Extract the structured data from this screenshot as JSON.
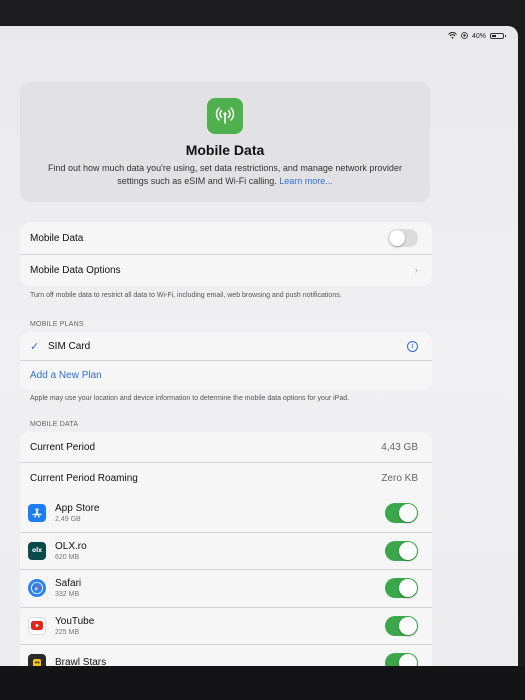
{
  "status": {
    "battery": "40%",
    "battery_level": 0.4
  },
  "header": {
    "icon": "antenna-icon",
    "title": "Mobile Data",
    "description": "Find out how much data you're using, set data restrictions, and manage network provider settings such as eSIM and Wi-Fi calling.",
    "learn_more": "Learn more..."
  },
  "main_settings": {
    "mobile_data_label": "Mobile Data",
    "mobile_data_on": false,
    "options_label": "Mobile Data Options",
    "footer": "Turn off mobile data to restrict all data to Wi-Fi, including email, web browsing and push notifications."
  },
  "plans": {
    "section_title": "MOBILE PLANS",
    "sim_card": "SIM Card",
    "add_plan": "Add a New Plan",
    "footer": "Apple may use your location and device information to determine the mobile data options for your iPad."
  },
  "usage": {
    "section_title": "MOBILE DATA",
    "current_period_label": "Current Period",
    "current_period_value": "4,43 GB",
    "roaming_label": "Current Period Roaming",
    "roaming_value": "Zero KB"
  },
  "apps": [
    {
      "name": "App Store",
      "size": "2,49 GB",
      "on": true,
      "icon": "app-store-icon",
      "color": "#1f7cf2"
    },
    {
      "name": "OLX.ro",
      "size": "620 MB",
      "on": true,
      "icon": "olx-icon",
      "color": "#0b4a4a"
    },
    {
      "name": "Safari",
      "size": "332 MB",
      "on": true,
      "icon": "safari-icon",
      "color": "#2b82f0"
    },
    {
      "name": "YouTube",
      "size": "225 MB",
      "on": true,
      "icon": "youtube-icon",
      "color": "#ffffff"
    },
    {
      "name": "Brawl Stars",
      "size": "",
      "on": true,
      "icon": "brawl-stars-icon",
      "color": "#2a2a2a"
    }
  ]
}
